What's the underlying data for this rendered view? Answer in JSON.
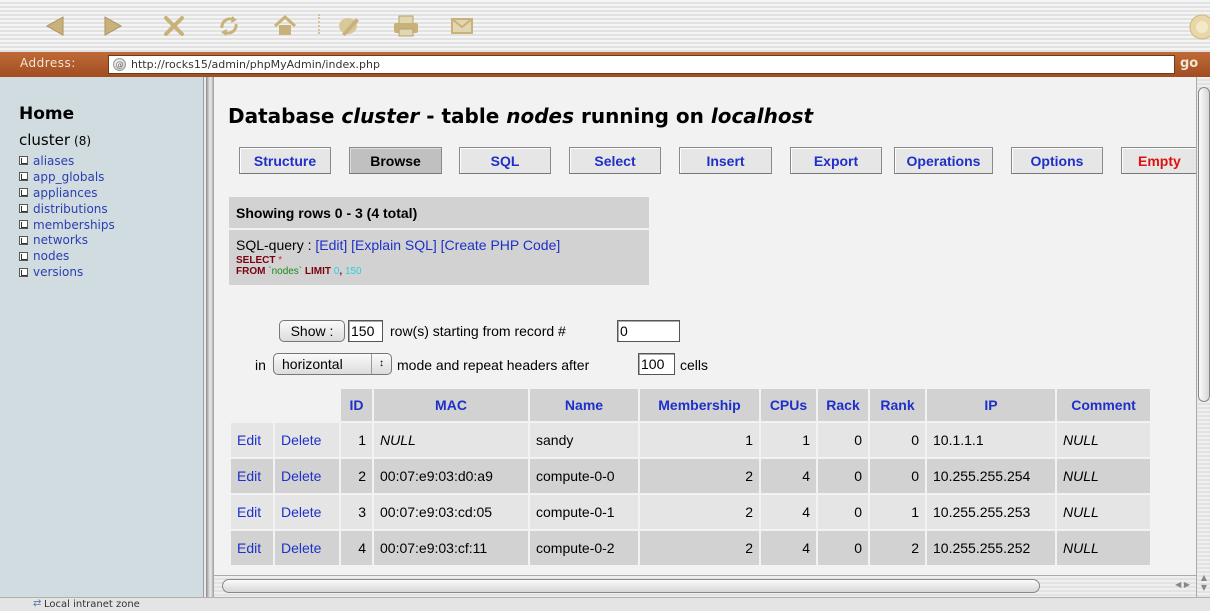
{
  "toolbar": {
    "buttons": [
      "back-icon",
      "forward-icon",
      "stop-icon",
      "refresh-icon",
      "home-icon",
      "edit-icon",
      "print-icon",
      "mail-icon"
    ]
  },
  "address": {
    "label": "Address:",
    "url": "http://rocks15/admin/phpMyAdmin/index.php",
    "go_label": "go"
  },
  "sidebar": {
    "home": "Home",
    "database": "cluster",
    "table_count": "(8)",
    "tables": [
      "aliases",
      "app_globals",
      "appliances",
      "distributions",
      "memberships",
      "networks",
      "nodes",
      "versions"
    ]
  },
  "main": {
    "title_prefix": "Database ",
    "db": "cluster",
    "title_mid": " - table ",
    "table": "nodes",
    "title_mid2": " running on ",
    "host": "localhost",
    "tabs": [
      {
        "label": "Structure"
      },
      {
        "label": "Browse",
        "active": true
      },
      {
        "label": "SQL"
      },
      {
        "label": "Select"
      },
      {
        "label": "Insert"
      },
      {
        "label": "Export"
      },
      {
        "label": "Operations"
      },
      {
        "label": "Options"
      },
      {
        "label": "Empty"
      }
    ],
    "showing_rows": "Showing rows 0 - 3 (4 total)",
    "sql_query_label": "SQL-query : ",
    "edit_link": "[Edit]",
    "explain_link": "[Explain SQL]",
    "create_php_link": "[Create PHP Code]",
    "sql_select": "SELECT",
    "sql_star": "*",
    "sql_from": "FROM",
    "sql_table": "`nodes`",
    "sql_limit": "LIMIT",
    "sql_offset": "0",
    "sql_count": "150"
  },
  "navform": {
    "show_button": "Show :",
    "rows_value": "150",
    "rows_text": "row(s) starting from record #",
    "start_value": "0",
    "in_text": "in",
    "mode_value": "horizontal",
    "mode_arrow": "↕",
    "repeat_text": "mode and repeat headers after",
    "repeat_value": "100",
    "cells_text": "cells"
  },
  "results": {
    "headers": [
      "ID",
      "MAC",
      "Name",
      "Membership",
      "CPUs",
      "Rack",
      "Rank",
      "IP",
      "Comment"
    ],
    "edit_label": "Edit",
    "delete_label": "Delete",
    "rows": [
      [
        "1",
        "NULL",
        "sandy",
        "1",
        "1",
        "0",
        "0",
        "10.1.1.1",
        "NULL"
      ],
      [
        "2",
        "00:07:e9:03:d0:a9",
        "compute-0-0",
        "2",
        "4",
        "0",
        "0",
        "10.255.255.254",
        "NULL"
      ],
      [
        "3",
        "00:07:e9:03:cd:05",
        "compute-0-1",
        "2",
        "4",
        "0",
        "1",
        "10.255.255.253",
        "NULL"
      ],
      [
        "4",
        "00:07:e9:03:cf:11",
        "compute-0-2",
        "2",
        "4",
        "0",
        "2",
        "10.255.255.252",
        "NULL"
      ]
    ]
  },
  "status": {
    "zone": "Local intranet zone"
  },
  "colors": {
    "link": "#1e30c8",
    "danger": "#e01010",
    "address_bar": "#b05a2c",
    "sidebar_bg": "#d0dce0"
  }
}
